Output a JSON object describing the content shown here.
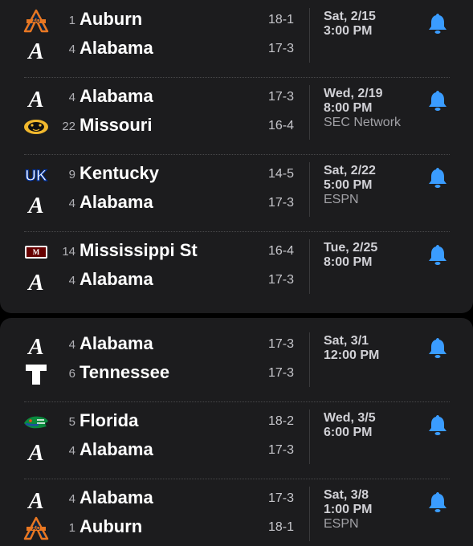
{
  "accent_color": "#3a9cff",
  "games": [
    {
      "teams": [
        {
          "rank": "1",
          "name": "Auburn",
          "record": "18-1",
          "logo": "auburn-logo"
        },
        {
          "rank": "4",
          "name": "Alabama",
          "record": "17-3",
          "logo": "alabama-logo"
        }
      ],
      "date": "Sat, 2/15",
      "time": "3:00 PM",
      "network": ""
    },
    {
      "teams": [
        {
          "rank": "4",
          "name": "Alabama",
          "record": "17-3",
          "logo": "alabama-logo"
        },
        {
          "rank": "22",
          "name": "Missouri",
          "record": "16-4",
          "logo": "missouri-logo"
        }
      ],
      "date": "Wed, 2/19",
      "time": "8:00 PM",
      "network": "SEC Network"
    },
    {
      "teams": [
        {
          "rank": "9",
          "name": "Kentucky",
          "record": "14-5",
          "logo": "kentucky-logo"
        },
        {
          "rank": "4",
          "name": "Alabama",
          "record": "17-3",
          "logo": "alabama-logo"
        }
      ],
      "date": "Sat, 2/22",
      "time": "5:00 PM",
      "network": "ESPN"
    },
    {
      "teams": [
        {
          "rank": "14",
          "name": "Mississippi St",
          "record": "16-4",
          "logo": "mississippi-state-logo"
        },
        {
          "rank": "4",
          "name": "Alabama",
          "record": "17-3",
          "logo": "alabama-logo"
        }
      ],
      "date": "Tue, 2/25",
      "time": "8:00 PM",
      "network": ""
    },
    {
      "teams": [
        {
          "rank": "4",
          "name": "Alabama",
          "record": "17-3",
          "logo": "alabama-logo"
        },
        {
          "rank": "6",
          "name": "Tennessee",
          "record": "17-3",
          "logo": "tennessee-logo"
        }
      ],
      "date": "Sat, 3/1",
      "time": "12:00 PM",
      "network": ""
    },
    {
      "teams": [
        {
          "rank": "5",
          "name": "Florida",
          "record": "18-2",
          "logo": "florida-logo"
        },
        {
          "rank": "4",
          "name": "Alabama",
          "record": "17-3",
          "logo": "alabama-logo"
        }
      ],
      "date": "Wed, 3/5",
      "time": "6:00 PM",
      "network": ""
    },
    {
      "teams": [
        {
          "rank": "4",
          "name": "Alabama",
          "record": "17-3",
          "logo": "alabama-logo"
        },
        {
          "rank": "1",
          "name": "Auburn",
          "record": "18-1",
          "logo": "auburn-logo"
        }
      ],
      "date": "Sat, 3/8",
      "time": "1:00 PM",
      "network": "ESPN"
    }
  ]
}
